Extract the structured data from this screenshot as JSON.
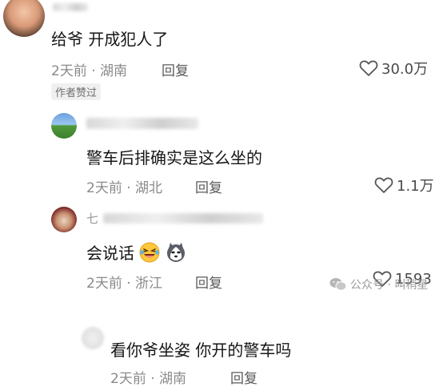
{
  "comments": [
    {
      "text": "给爷 开成犯人了",
      "time_location": "2天前 · 湖南",
      "reply_label": "回复",
      "likes": "30.0万",
      "badge": "作者赞过"
    },
    {
      "text": "警车后排确实是这么坐的",
      "time_location": "2天前 · 湖北",
      "reply_label": "回复",
      "likes": "1.1万"
    },
    {
      "username_prefix": "七",
      "text": "会说话",
      "time_location": "2天前 · 浙江",
      "reply_label": "回复",
      "likes": "1593"
    },
    {
      "text": "看你爷坐姿 你开的警车吗",
      "time_location": "2天前 · 湖南",
      "reply_label": "回复"
    }
  ],
  "watermark": "公众号 · 叫稍星"
}
